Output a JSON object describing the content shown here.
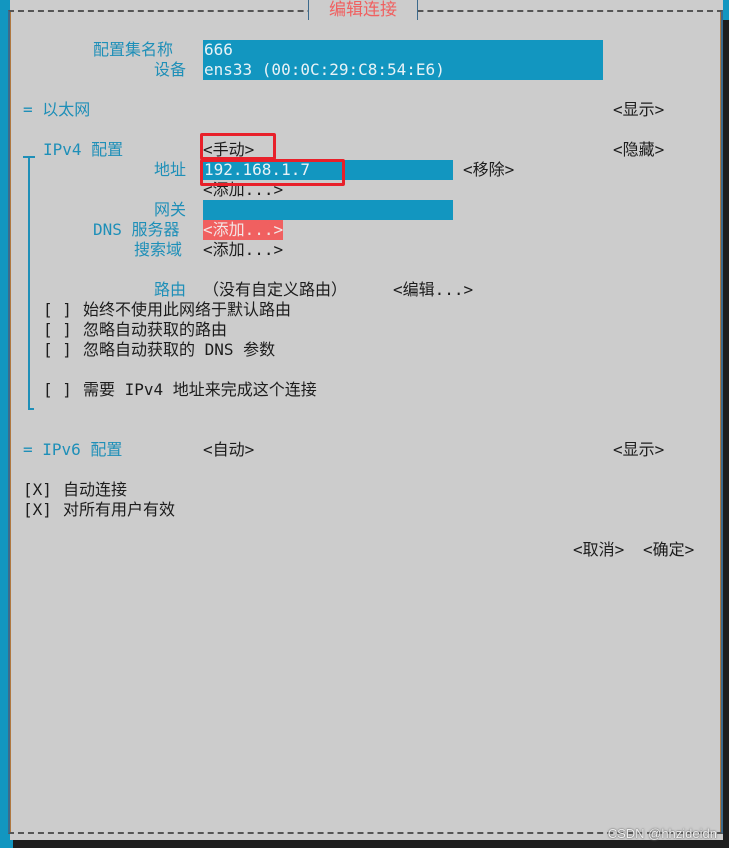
{
  "dialog": {
    "title": "编辑连接"
  },
  "profile": {
    "name_label": "配置集名称",
    "name_value": "666",
    "device_label": "设备",
    "device_value": "ens33 (00:0C:29:C8:54:E6)"
  },
  "ethernet": {
    "label": "= 以太网",
    "toggle": "<显示>"
  },
  "ipv4": {
    "label": "IPv4 配置",
    "prefix": "=",
    "mode": "<手动>",
    "toggle": "<隐藏>",
    "address_label": "地址",
    "address_value": "192.168.1.7",
    "remove_button": "<移除>",
    "add_address_button": "<添加...>",
    "gateway_label": "网关",
    "gateway_value": "",
    "dns_label": "DNS 服务器",
    "dns_add_button": "<添加...>",
    "search_label": "搜索域",
    "search_add_button": "<添加...>",
    "routing_label": "路由",
    "routing_value": "（没有自定义路由）",
    "routing_edit_button": "<编辑...>",
    "checkboxes": [
      {
        "mark": "[ ]",
        "label": "始终不使用此网络于默认路由",
        "checked": false
      },
      {
        "mark": "[ ]",
        "label": "忽略自动获取的路由",
        "checked": false
      },
      {
        "mark": "[ ]",
        "label": "忽略自动获取的 DNS 参数",
        "checked": false
      },
      {
        "mark": "[ ]",
        "label": "需要 IPv4 地址来完成这个连接",
        "checked": false
      }
    ]
  },
  "ipv6": {
    "label": "= IPv6 配置",
    "mode": "<自动>",
    "toggle": "<显示>"
  },
  "options": [
    {
      "mark": "[X]",
      "label": "自动连接",
      "checked": true
    },
    {
      "mark": "[X]",
      "label": "对所有用户有效",
      "checked": true
    }
  ],
  "actions": {
    "cancel": "<取消>",
    "ok": "<确定>"
  },
  "watermark": "CSDN @hhzideidn",
  "colors": {
    "background": "#cccccc",
    "accent": "#1296c0",
    "title": "#f06060",
    "focus_highlight": "#f06060",
    "annotation": "#e8202a"
  }
}
